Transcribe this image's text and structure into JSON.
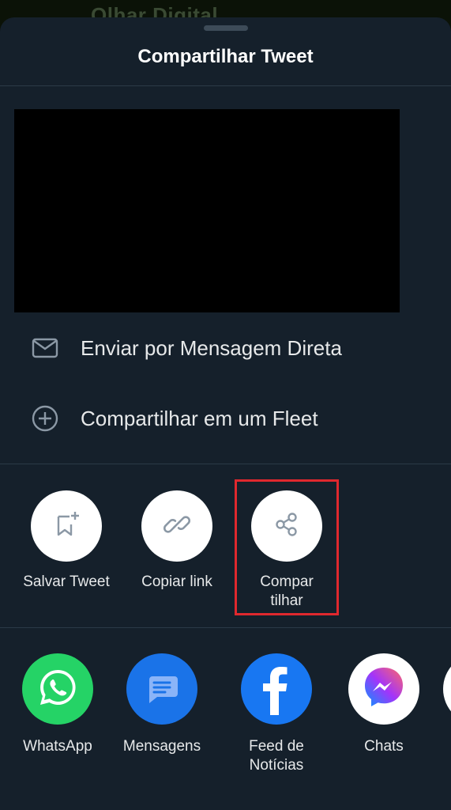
{
  "background_title": "Olhar Digital",
  "sheet": {
    "title": "Compartilhar Tweet"
  },
  "menu": {
    "dm_label": "Enviar por Mensagem Direta",
    "fleet_label": "Compartilhar em um Fleet"
  },
  "actions": {
    "save_label": "Salvar Tweet",
    "copy_label": "Copiar link",
    "share_label_line1": "Compar",
    "share_label_line2": "tilhar"
  },
  "apps": {
    "whatsapp": "WhatsApp",
    "messages": "Mensagens",
    "facebook_line1": "Feed de",
    "facebook_line2": "Notícias",
    "chats": "Chats"
  },
  "colors": {
    "sheet_bg": "#15202b",
    "highlight": "#e0282e",
    "whatsapp": "#25d366",
    "messages": "#1a73e8",
    "facebook": "#1877f2",
    "messenger_gradient_start": "#0695ff",
    "messenger_gradient_end": "#ff6968"
  }
}
